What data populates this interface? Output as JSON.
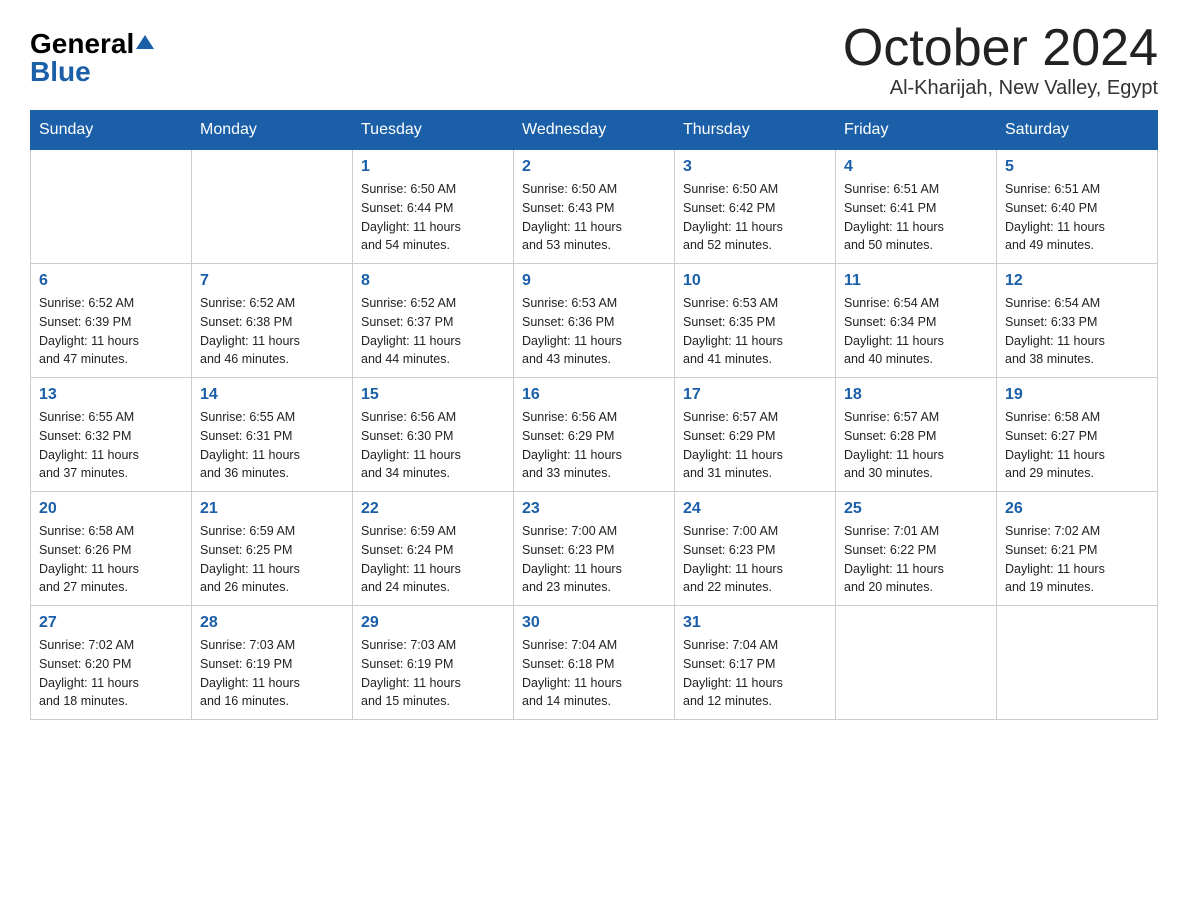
{
  "logo": {
    "general": "General",
    "blue": "Blue",
    "triangle": "▲"
  },
  "title": "October 2024",
  "subtitle": "Al-Kharijah, New Valley, Egypt",
  "days_of_week": [
    "Sunday",
    "Monday",
    "Tuesday",
    "Wednesday",
    "Thursday",
    "Friday",
    "Saturday"
  ],
  "weeks": [
    [
      {
        "day": "",
        "info": ""
      },
      {
        "day": "",
        "info": ""
      },
      {
        "day": "1",
        "info": "Sunrise: 6:50 AM\nSunset: 6:44 PM\nDaylight: 11 hours\nand 54 minutes."
      },
      {
        "day": "2",
        "info": "Sunrise: 6:50 AM\nSunset: 6:43 PM\nDaylight: 11 hours\nand 53 minutes."
      },
      {
        "day": "3",
        "info": "Sunrise: 6:50 AM\nSunset: 6:42 PM\nDaylight: 11 hours\nand 52 minutes."
      },
      {
        "day": "4",
        "info": "Sunrise: 6:51 AM\nSunset: 6:41 PM\nDaylight: 11 hours\nand 50 minutes."
      },
      {
        "day": "5",
        "info": "Sunrise: 6:51 AM\nSunset: 6:40 PM\nDaylight: 11 hours\nand 49 minutes."
      }
    ],
    [
      {
        "day": "6",
        "info": "Sunrise: 6:52 AM\nSunset: 6:39 PM\nDaylight: 11 hours\nand 47 minutes."
      },
      {
        "day": "7",
        "info": "Sunrise: 6:52 AM\nSunset: 6:38 PM\nDaylight: 11 hours\nand 46 minutes."
      },
      {
        "day": "8",
        "info": "Sunrise: 6:52 AM\nSunset: 6:37 PM\nDaylight: 11 hours\nand 44 minutes."
      },
      {
        "day": "9",
        "info": "Sunrise: 6:53 AM\nSunset: 6:36 PM\nDaylight: 11 hours\nand 43 minutes."
      },
      {
        "day": "10",
        "info": "Sunrise: 6:53 AM\nSunset: 6:35 PM\nDaylight: 11 hours\nand 41 minutes."
      },
      {
        "day": "11",
        "info": "Sunrise: 6:54 AM\nSunset: 6:34 PM\nDaylight: 11 hours\nand 40 minutes."
      },
      {
        "day": "12",
        "info": "Sunrise: 6:54 AM\nSunset: 6:33 PM\nDaylight: 11 hours\nand 38 minutes."
      }
    ],
    [
      {
        "day": "13",
        "info": "Sunrise: 6:55 AM\nSunset: 6:32 PM\nDaylight: 11 hours\nand 37 minutes."
      },
      {
        "day": "14",
        "info": "Sunrise: 6:55 AM\nSunset: 6:31 PM\nDaylight: 11 hours\nand 36 minutes."
      },
      {
        "day": "15",
        "info": "Sunrise: 6:56 AM\nSunset: 6:30 PM\nDaylight: 11 hours\nand 34 minutes."
      },
      {
        "day": "16",
        "info": "Sunrise: 6:56 AM\nSunset: 6:29 PM\nDaylight: 11 hours\nand 33 minutes."
      },
      {
        "day": "17",
        "info": "Sunrise: 6:57 AM\nSunset: 6:29 PM\nDaylight: 11 hours\nand 31 minutes."
      },
      {
        "day": "18",
        "info": "Sunrise: 6:57 AM\nSunset: 6:28 PM\nDaylight: 11 hours\nand 30 minutes."
      },
      {
        "day": "19",
        "info": "Sunrise: 6:58 AM\nSunset: 6:27 PM\nDaylight: 11 hours\nand 29 minutes."
      }
    ],
    [
      {
        "day": "20",
        "info": "Sunrise: 6:58 AM\nSunset: 6:26 PM\nDaylight: 11 hours\nand 27 minutes."
      },
      {
        "day": "21",
        "info": "Sunrise: 6:59 AM\nSunset: 6:25 PM\nDaylight: 11 hours\nand 26 minutes."
      },
      {
        "day": "22",
        "info": "Sunrise: 6:59 AM\nSunset: 6:24 PM\nDaylight: 11 hours\nand 24 minutes."
      },
      {
        "day": "23",
        "info": "Sunrise: 7:00 AM\nSunset: 6:23 PM\nDaylight: 11 hours\nand 23 minutes."
      },
      {
        "day": "24",
        "info": "Sunrise: 7:00 AM\nSunset: 6:23 PM\nDaylight: 11 hours\nand 22 minutes."
      },
      {
        "day": "25",
        "info": "Sunrise: 7:01 AM\nSunset: 6:22 PM\nDaylight: 11 hours\nand 20 minutes."
      },
      {
        "day": "26",
        "info": "Sunrise: 7:02 AM\nSunset: 6:21 PM\nDaylight: 11 hours\nand 19 minutes."
      }
    ],
    [
      {
        "day": "27",
        "info": "Sunrise: 7:02 AM\nSunset: 6:20 PM\nDaylight: 11 hours\nand 18 minutes."
      },
      {
        "day": "28",
        "info": "Sunrise: 7:03 AM\nSunset: 6:19 PM\nDaylight: 11 hours\nand 16 minutes."
      },
      {
        "day": "29",
        "info": "Sunrise: 7:03 AM\nSunset: 6:19 PM\nDaylight: 11 hours\nand 15 minutes."
      },
      {
        "day": "30",
        "info": "Sunrise: 7:04 AM\nSunset: 6:18 PM\nDaylight: 11 hours\nand 14 minutes."
      },
      {
        "day": "31",
        "info": "Sunrise: 7:04 AM\nSunset: 6:17 PM\nDaylight: 11 hours\nand 12 minutes."
      },
      {
        "day": "",
        "info": ""
      },
      {
        "day": "",
        "info": ""
      }
    ]
  ]
}
